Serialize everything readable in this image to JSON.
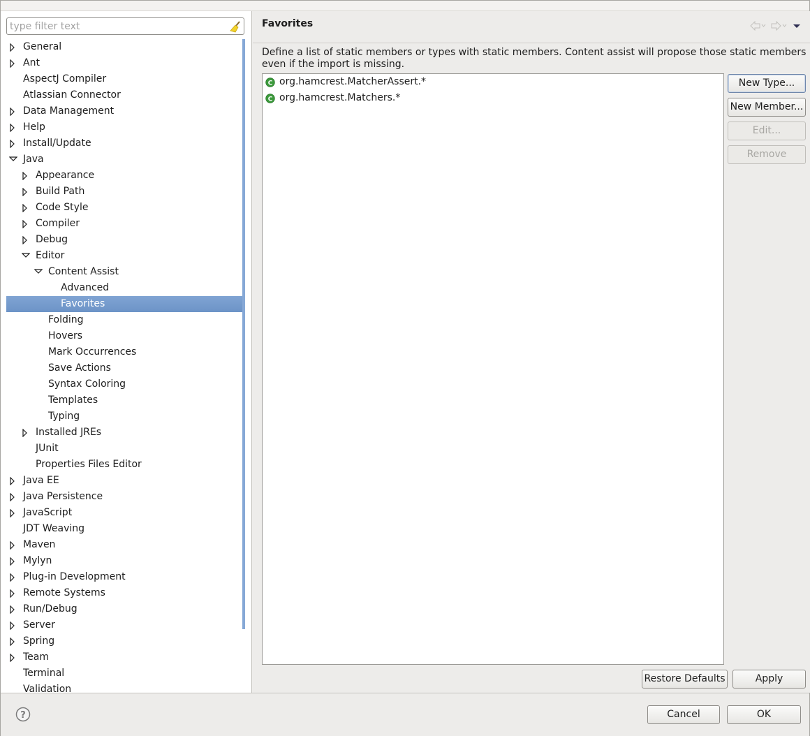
{
  "filter": {
    "placeholder": "type filter text",
    "value": ""
  },
  "tree": [
    {
      "label": "General",
      "depth": 0,
      "twisty": "collapsed"
    },
    {
      "label": "Ant",
      "depth": 0,
      "twisty": "collapsed"
    },
    {
      "label": "AspectJ Compiler",
      "depth": 0,
      "twisty": "none"
    },
    {
      "label": "Atlassian Connector",
      "depth": 0,
      "twisty": "none"
    },
    {
      "label": "Data Management",
      "depth": 0,
      "twisty": "collapsed"
    },
    {
      "label": "Help",
      "depth": 0,
      "twisty": "collapsed"
    },
    {
      "label": "Install/Update",
      "depth": 0,
      "twisty": "collapsed"
    },
    {
      "label": "Java",
      "depth": 0,
      "twisty": "expanded"
    },
    {
      "label": "Appearance",
      "depth": 1,
      "twisty": "collapsed"
    },
    {
      "label": "Build Path",
      "depth": 1,
      "twisty": "collapsed"
    },
    {
      "label": "Code Style",
      "depth": 1,
      "twisty": "collapsed"
    },
    {
      "label": "Compiler",
      "depth": 1,
      "twisty": "collapsed"
    },
    {
      "label": "Debug",
      "depth": 1,
      "twisty": "collapsed"
    },
    {
      "label": "Editor",
      "depth": 1,
      "twisty": "expanded"
    },
    {
      "label": "Content Assist",
      "depth": 2,
      "twisty": "expanded"
    },
    {
      "label": "Advanced",
      "depth": 3,
      "twisty": "none"
    },
    {
      "label": "Favorites",
      "depth": 3,
      "twisty": "none",
      "selected": true
    },
    {
      "label": "Folding",
      "depth": 2,
      "twisty": "none"
    },
    {
      "label": "Hovers",
      "depth": 2,
      "twisty": "none"
    },
    {
      "label": "Mark Occurrences",
      "depth": 2,
      "twisty": "none"
    },
    {
      "label": "Save Actions",
      "depth": 2,
      "twisty": "none"
    },
    {
      "label": "Syntax Coloring",
      "depth": 2,
      "twisty": "none"
    },
    {
      "label": "Templates",
      "depth": 2,
      "twisty": "none"
    },
    {
      "label": "Typing",
      "depth": 2,
      "twisty": "none"
    },
    {
      "label": "Installed JREs",
      "depth": 1,
      "twisty": "collapsed"
    },
    {
      "label": "JUnit",
      "depth": 1,
      "twisty": "none"
    },
    {
      "label": "Properties Files Editor",
      "depth": 1,
      "twisty": "none"
    },
    {
      "label": "Java EE",
      "depth": 0,
      "twisty": "collapsed"
    },
    {
      "label": "Java Persistence",
      "depth": 0,
      "twisty": "collapsed"
    },
    {
      "label": "JavaScript",
      "depth": 0,
      "twisty": "collapsed"
    },
    {
      "label": "JDT Weaving",
      "depth": 0,
      "twisty": "none"
    },
    {
      "label": "Maven",
      "depth": 0,
      "twisty": "collapsed"
    },
    {
      "label": "Mylyn",
      "depth": 0,
      "twisty": "collapsed"
    },
    {
      "label": "Plug-in Development",
      "depth": 0,
      "twisty": "collapsed"
    },
    {
      "label": "Remote Systems",
      "depth": 0,
      "twisty": "collapsed"
    },
    {
      "label": "Run/Debug",
      "depth": 0,
      "twisty": "collapsed"
    },
    {
      "label": "Server",
      "depth": 0,
      "twisty": "collapsed"
    },
    {
      "label": "Spring",
      "depth": 0,
      "twisty": "collapsed"
    },
    {
      "label": "Team",
      "depth": 0,
      "twisty": "collapsed"
    },
    {
      "label": "Terminal",
      "depth": 0,
      "twisty": "none"
    },
    {
      "label": "Validation",
      "depth": 0,
      "twisty": "none"
    }
  ],
  "page": {
    "title": "Favorites",
    "description": "Define a list of static members or types with static members. Content assist will propose those static members even if the import is missing.",
    "favorites": [
      {
        "label": "org.hamcrest.MatcherAssert.*",
        "icon": "class-icon"
      },
      {
        "label": "org.hamcrest.Matchers.*",
        "icon": "class-icon"
      }
    ],
    "buttons": {
      "new_type": "New Type...",
      "new_member": "New Member...",
      "edit": "Edit...",
      "remove": "Remove",
      "restore_defaults": "Restore Defaults",
      "apply": "Apply"
    }
  },
  "dialog": {
    "cancel": "Cancel",
    "ok": "OK"
  },
  "colors": {
    "selection": "#7399cc",
    "class_icon": "#3c9a3c",
    "scroll_accent": "#86a8d6"
  }
}
